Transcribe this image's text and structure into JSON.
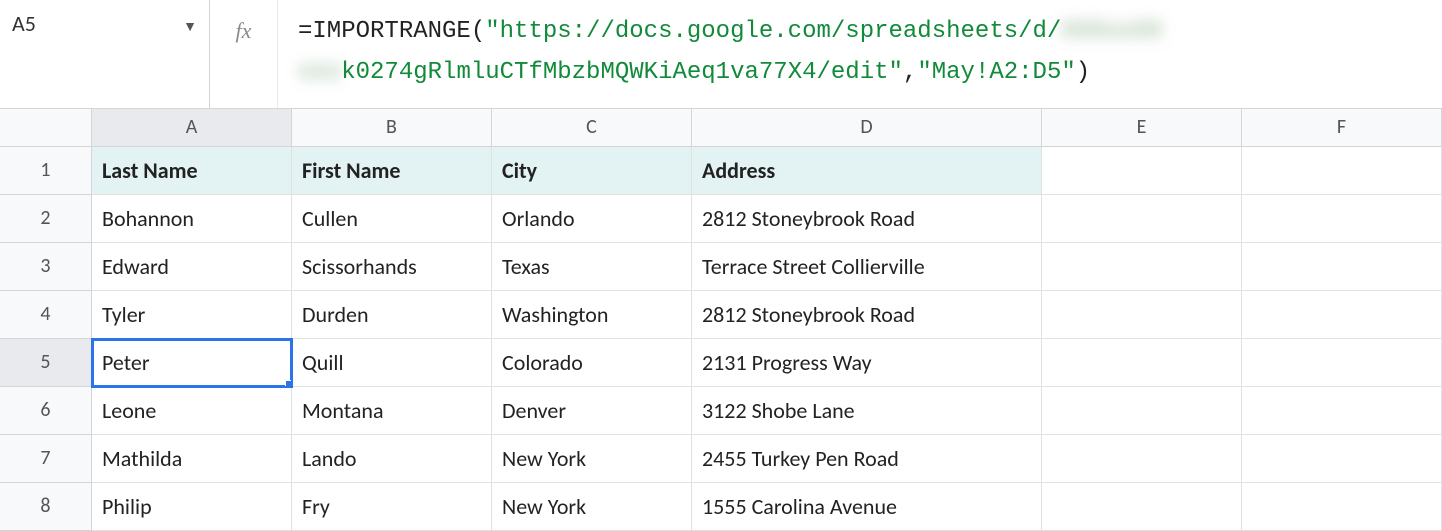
{
  "name_box": "A5",
  "fx_label": "fx",
  "formula": {
    "prefix": "=IMPORTRANGE(",
    "str_part1": "\"https://docs.google.com/spreadsheets/d/",
    "blur1": "XXXxxXX",
    "str_part2_start": "xxx",
    "str_part2": "k0274gRlmluCTfMbzbMQWKiAeq1va77X4/edit\"",
    "comma": ",",
    "str_range": "\"May!A2:D5\"",
    "suffix": ")"
  },
  "columns": [
    "A",
    "B",
    "C",
    "D",
    "E",
    "F"
  ],
  "rows": [
    "1",
    "2",
    "3",
    "4",
    "5",
    "6",
    "7",
    "8"
  ],
  "selected": {
    "row": 5,
    "col": 1
  },
  "table": {
    "headers": {
      "A": "Last Name",
      "B": "First Name",
      "C": "City",
      "D": "Address"
    },
    "data": [
      {
        "A": "Bohannon",
        "B": "Cullen",
        "C": "Orlando",
        "D": "2812 Stoneybrook Road"
      },
      {
        "A": "Edward",
        "B": "Scissorhands",
        "C": "Texas",
        "D": "Terrace Street Collierville"
      },
      {
        "A": "Tyler",
        "B": "Durden",
        "C": "Washington",
        "D": "2812 Stoneybrook Road"
      },
      {
        "A": "Peter",
        "B": "Quill",
        "C": "Colorado",
        "D": "2131 Progress Way"
      },
      {
        "A": "Leone",
        "B": "Montana",
        "C": "Denver",
        "D": "3122 Shobe Lane"
      },
      {
        "A": "Mathilda",
        "B": "Lando",
        "C": "New York",
        "D": "2455 Turkey Pen Road"
      },
      {
        "A": "Philip",
        "B": "Fry",
        "C": "New York",
        "D": "1555 Carolina Avenue"
      }
    ]
  }
}
